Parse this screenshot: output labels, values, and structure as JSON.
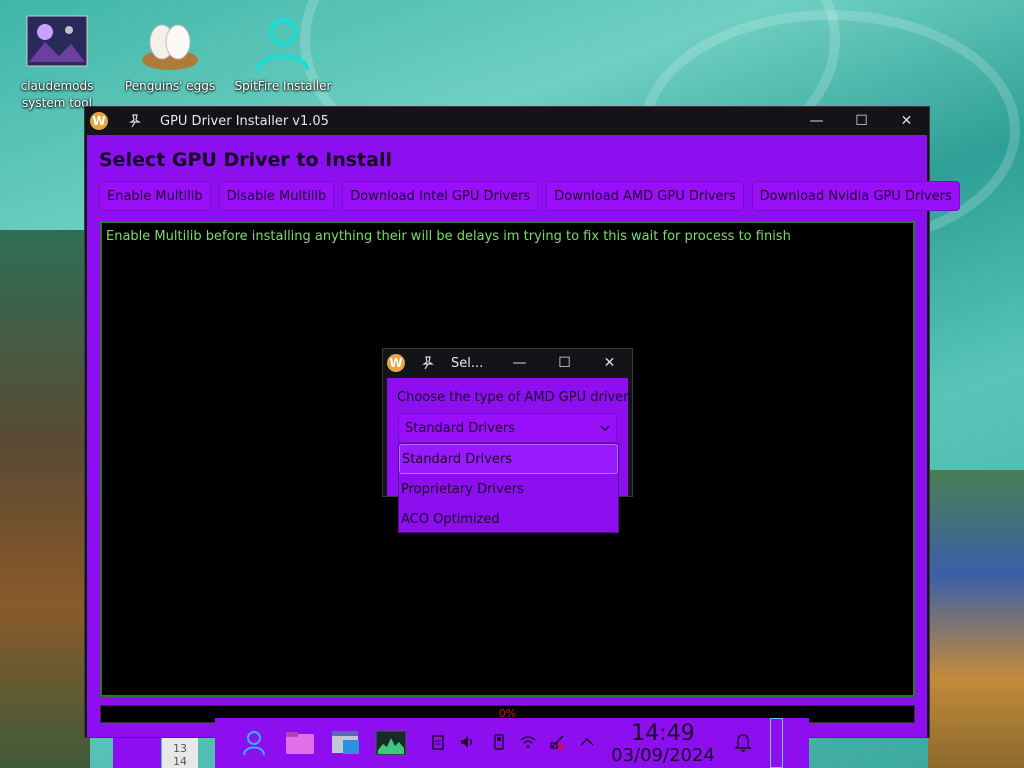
{
  "desktop": {
    "icons": [
      {
        "label": "claudemods system tool",
        "icon": "wallpaper-thumbnail-icon"
      },
      {
        "label": "Penguins' eggs",
        "icon": "eggs-icon"
      },
      {
        "label": "SpitFire Installer",
        "icon": "user-icon"
      }
    ]
  },
  "main_window": {
    "title": "GPU Driver Installer v1.05",
    "heading": "Select GPU Driver to Install",
    "buttons": [
      "Enable Multilib",
      "Disable Multilib",
      "Download Intel GPU Drivers",
      "Download AMD GPU Drivers",
      "Download Nvidia GPU Drivers"
    ],
    "console_text": "Enable Multilib before installing anything their will be delays im trying to fix this wait for process to finish",
    "progress": {
      "value": 0,
      "label": "0%"
    }
  },
  "dialog": {
    "title": "Sel...",
    "prompt": "Choose the type of AMD GPU driver:",
    "selected": "Standard Drivers",
    "options": [
      "Standard Drivers",
      "Proprietary Drivers",
      "ACO Optimized"
    ]
  },
  "taskbar": {
    "time": "14:49",
    "date": "03/09/2024",
    "side_numbers": [
      "13",
      "14"
    ],
    "tray_icons": [
      "clipboard-icon",
      "volume-icon",
      "usb-icon",
      "wifi-icon",
      "network-disconnected-icon",
      "chevron-up-icon"
    ]
  },
  "colors": {
    "window_bg": "#8d0ff0",
    "console_text": "#7ddc6a",
    "console_border": "#267a2a",
    "progress_text": "#d01010",
    "titlebar": "#131417"
  }
}
